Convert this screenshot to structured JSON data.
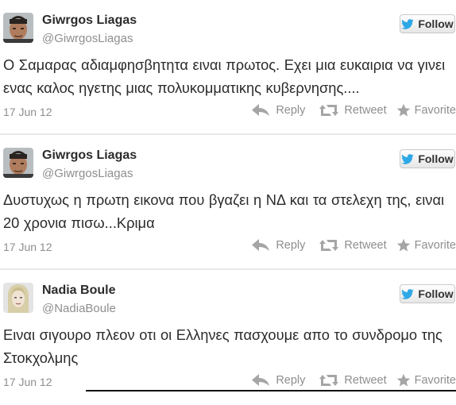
{
  "tweets": [
    {
      "name": "Giwrgos Liagas",
      "handle": "@GiwrgosLiagas",
      "text": "Ο Σαμαρας αδιαμφησβητητα ειναι πρωτος. Εχει μια ευκαιρια να γινει ενας καλος ηγετης μιας πολυκομματικης κυβερνησης....",
      "date": "17 Jun 12",
      "avatar_icon": "man-portrait-avatar"
    },
    {
      "name": "Giwrgos Liagas",
      "handle": "@GiwrgosLiagas",
      "text": "Δυστυχως η πρωτη εικονα που βγαζει η ΝΔ και τα στελεχη της, ειναι 20 χρονια πισω...Κριμα",
      "date": "17 Jun 12",
      "avatar_icon": "man-portrait-avatar"
    },
    {
      "name": "Nadia Boule",
      "handle": "@NadiaBoule",
      "text": "Ειναι σιγουρο πλεον οτι οι Ελληνες πασχουμε απο το συνδρομο της Στοκχολμης",
      "date": "17 Jun 12",
      "avatar_icon": "woman-portrait-avatar"
    }
  ],
  "labels": {
    "follow": "Follow",
    "reply": "Reply",
    "retweet": "Retweet",
    "favorite": "Favorite"
  },
  "colors": {
    "twitter_blue": "#2fa8e6",
    "muted_text": "#8e8e8e",
    "icon_gray": "#a5a5a5"
  }
}
